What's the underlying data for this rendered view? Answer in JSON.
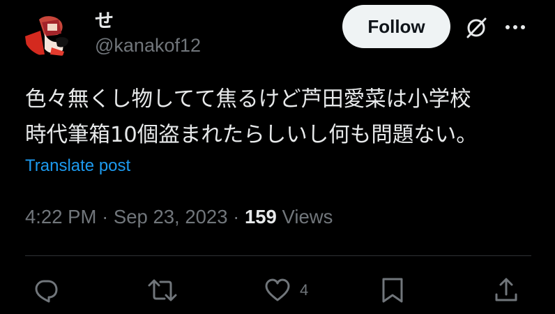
{
  "user": {
    "display_name": "せ",
    "handle": "@kanakof12"
  },
  "follow_label": "Follow",
  "tweet": {
    "text": "色々無くし物してて焦るけど芦田愛菜は小学校\n時代筆箱10個盗まれたらしいし何も問題ない。",
    "translate_label": "Translate post"
  },
  "meta": {
    "time": "4:22 PM",
    "separator": "·",
    "date": "Sep 23, 2023",
    "views_count": "159",
    "views_label": "Views"
  },
  "actions": {
    "reply_icon": "reply-icon",
    "repost_icon": "repost-icon",
    "like_icon": "heart-icon",
    "like_count": "4",
    "bookmark_icon": "bookmark-icon",
    "share_icon": "share-icon"
  },
  "colors": {
    "background": "#000000",
    "text": "#e7e9ea",
    "secondary": "#71767b",
    "link": "#1d9bf0",
    "follow_bg": "#eff3f4"
  }
}
